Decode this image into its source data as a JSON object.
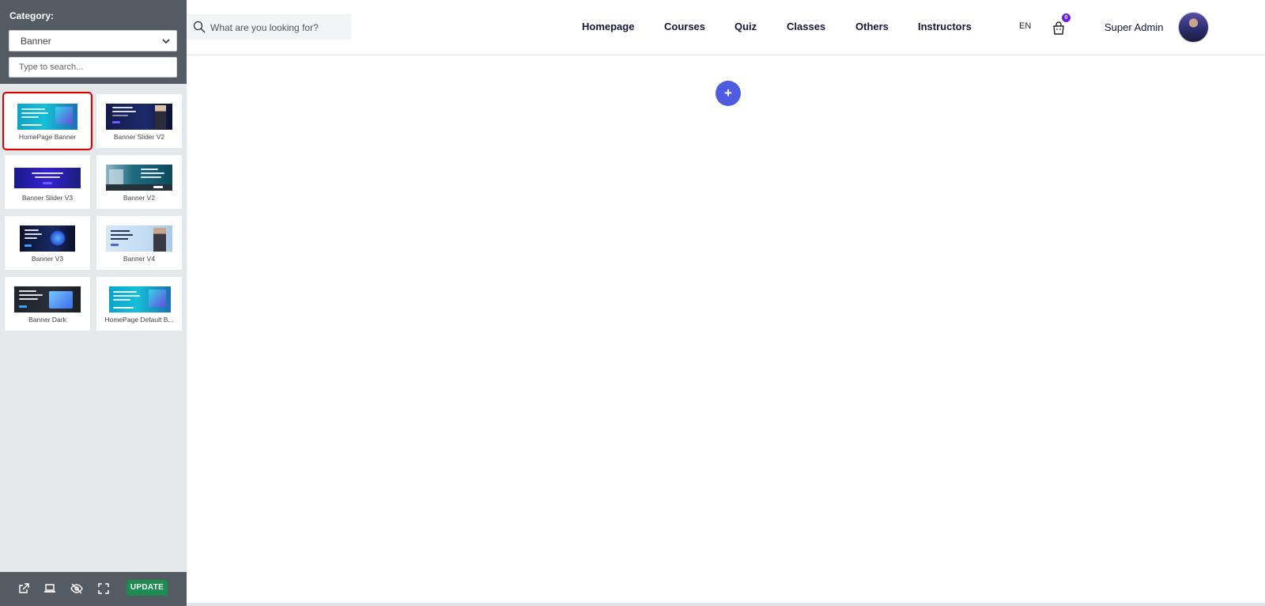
{
  "sidebar": {
    "category_label": "Category:",
    "category_selected": "Banner",
    "search_placeholder": "Type to search...",
    "templates": [
      {
        "name": "HomePage Banner",
        "selected": true
      },
      {
        "name": "Banner Slider V2",
        "selected": false
      },
      {
        "name": "Banner Slider V3",
        "selected": false
      },
      {
        "name": "Banner V2",
        "selected": false
      },
      {
        "name": "Banner V3",
        "selected": false
      },
      {
        "name": "Banner V4",
        "selected": false
      },
      {
        "name": "Banner Dark",
        "selected": false
      },
      {
        "name": "HomePage Default B...",
        "selected": false
      }
    ],
    "footer": {
      "icons": [
        "external-link-icon",
        "laptop-icon",
        "eye-off-icon",
        "fullscreen-icon"
      ],
      "update_label": "UPDATE"
    }
  },
  "header": {
    "search_placeholder": "What are you looking for?",
    "nav": [
      "Homepage",
      "Courses",
      "Quiz",
      "Classes",
      "Others",
      "Instructors"
    ],
    "language": "EN",
    "cart_count": "0",
    "user_name": "Super Admin"
  },
  "main": {
    "add_label": "+"
  },
  "colors": {
    "sidebar_dark": "#545b62",
    "sidebar_bg": "#e5e8eb",
    "update_green": "#1c8c50",
    "add_blue": "#4f5ce0",
    "nav_text": "#14163a",
    "badge_purple": "#6a1fe0",
    "selection_red": "#e00000"
  }
}
